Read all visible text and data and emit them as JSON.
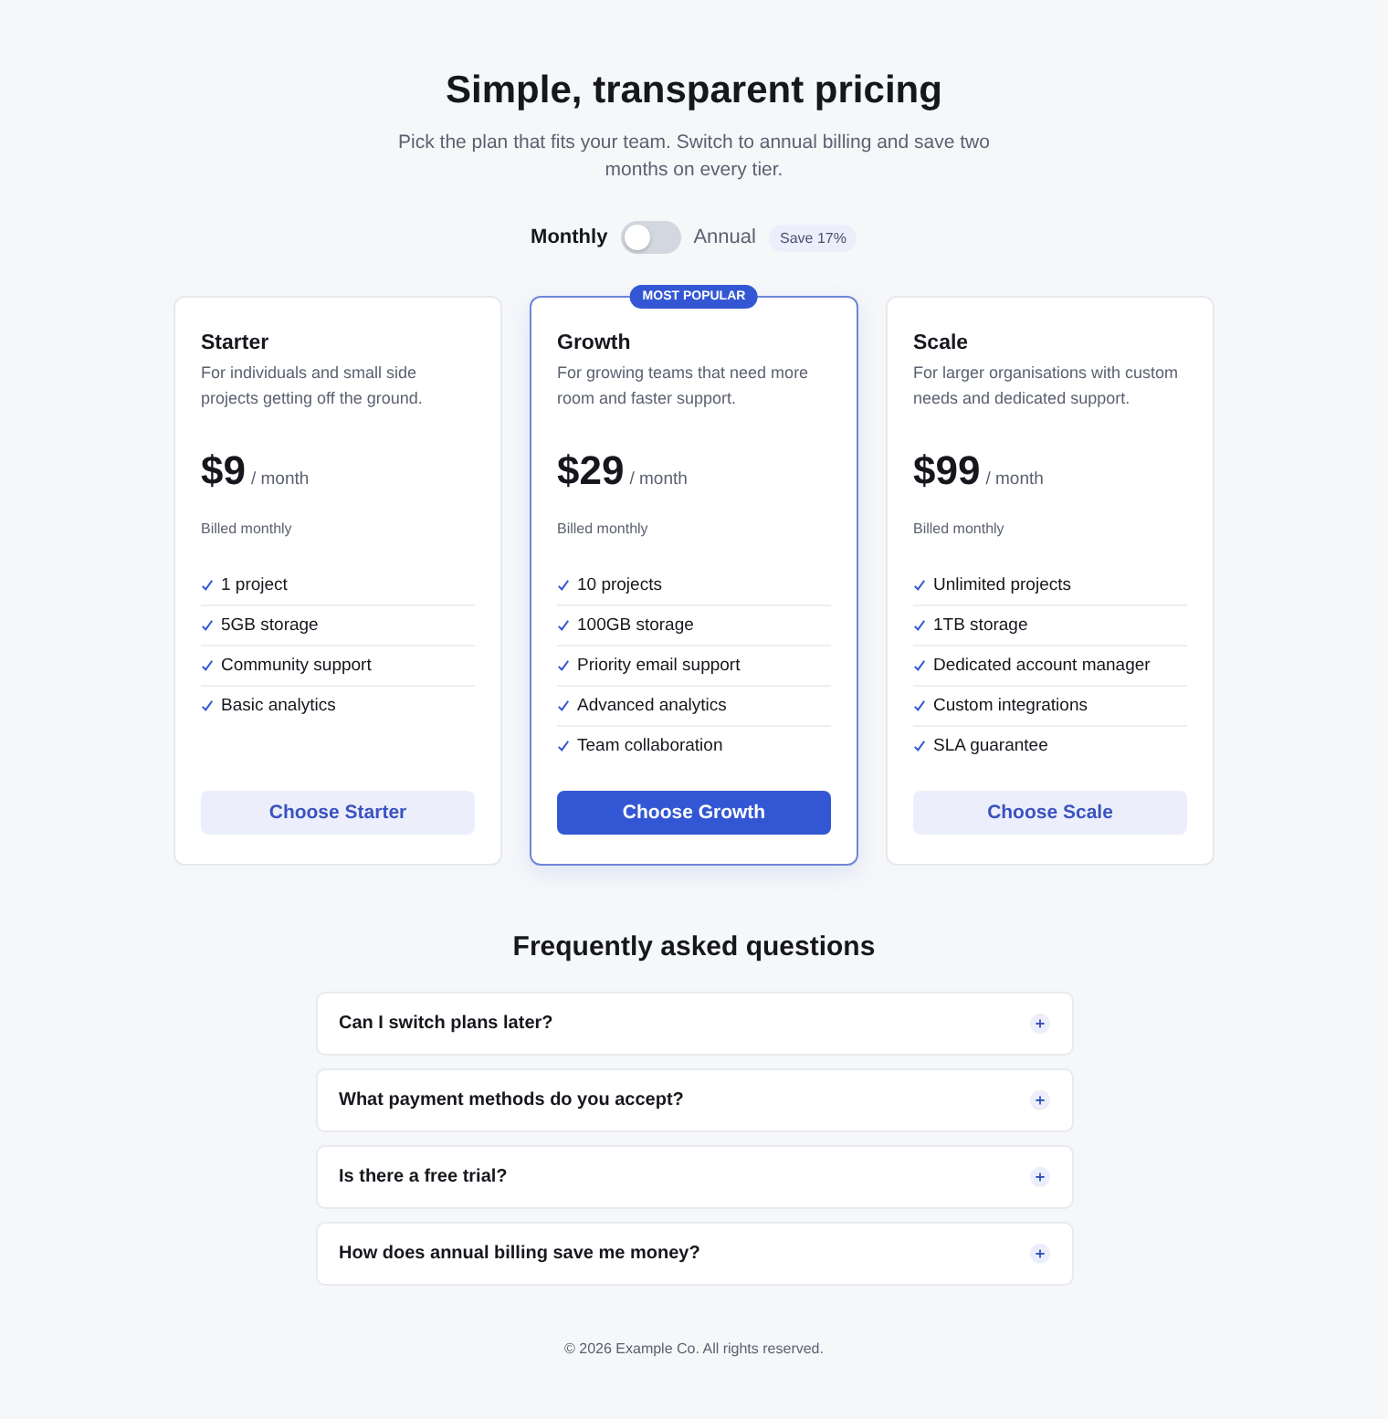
{
  "header": {
    "title": "Simple, transparent pricing",
    "subtitle": "Pick the plan that fits your team. Switch to annual billing and save two months on every tier."
  },
  "billing_toggle": {
    "monthly_label": "Monthly",
    "annual_label": "Annual",
    "on": false,
    "save_badge": "Save 17%"
  },
  "plans": [
    {
      "name": "Starter",
      "description": "For individuals and small side projects getting off the ground.",
      "price": "$9",
      "period": "/ month",
      "billing_note": "Billed monthly",
      "featured": false,
      "features": [
        "1 project",
        "5GB storage",
        "Community support",
        "Basic analytics"
      ],
      "button": "Choose Starter"
    },
    {
      "name": "Growth",
      "description": "For growing teams that need more room and faster support.",
      "price": "$29",
      "period": "/ month",
      "billing_note": "Billed monthly",
      "featured": true,
      "badge": "MOST POPULAR",
      "features": [
        "10 projects",
        "100GB storage",
        "Priority email support",
        "Advanced analytics",
        "Team collaboration"
      ],
      "button": "Choose Growth"
    },
    {
      "name": "Scale",
      "description": "For larger organisations with custom needs and dedicated support.",
      "price": "$99",
      "period": "/ month",
      "billing_note": "Billed monthly",
      "featured": false,
      "features": [
        "Unlimited projects",
        "1TB storage",
        "Dedicated account manager",
        "Custom integrations",
        "SLA guarantee"
      ],
      "button": "Choose Scale"
    }
  ],
  "faq": {
    "title": "Frequently asked questions",
    "items": [
      {
        "question": "Can I switch plans later?",
        "expanded": false
      },
      {
        "question": "What payment methods do you accept?",
        "expanded": false
      },
      {
        "question": "Is there a free trial?",
        "expanded": false
      },
      {
        "question": "How does annual billing save me money?",
        "expanded": false
      }
    ]
  },
  "footer": "© 2026 Example Co. All rights reserved."
}
